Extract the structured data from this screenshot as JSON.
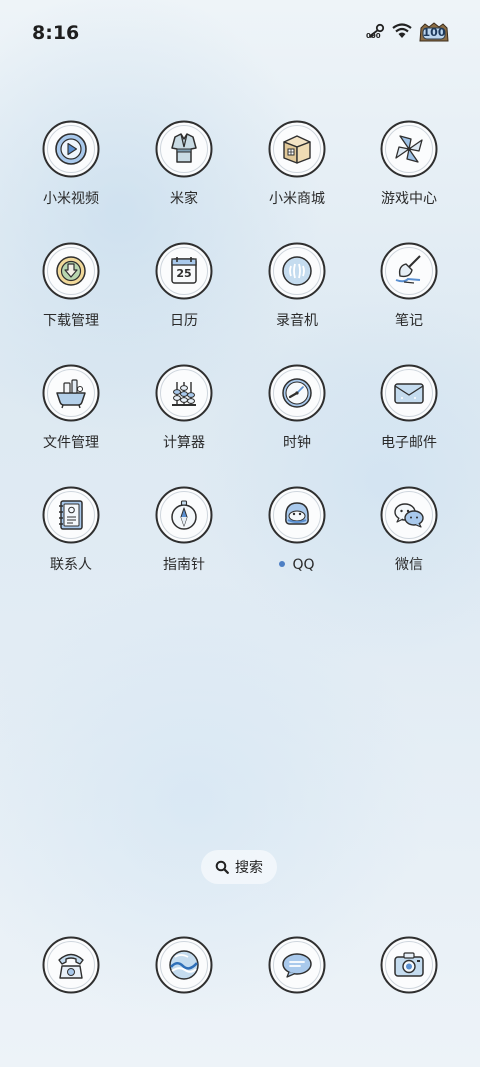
{
  "status_bar": {
    "time": "8:16",
    "battery_level": "100",
    "icons": [
      "key-icon",
      "wifi-icon",
      "battery-icon"
    ]
  },
  "apps": [
    {
      "label": "小米视频",
      "icon": "video-play-icon"
    },
    {
      "label": "米家",
      "icon": "robe-icon"
    },
    {
      "label": "小米商城",
      "icon": "shop-box-icon"
    },
    {
      "label": "游戏中心",
      "icon": "pinwheel-icon"
    },
    {
      "label": "下载管理",
      "icon": "download-arrow-icon"
    },
    {
      "label": "日历",
      "icon": "calendar-icon",
      "date": "25"
    },
    {
      "label": "录音机",
      "icon": "recorder-icon"
    },
    {
      "label": "笔记",
      "icon": "note-pen-icon"
    },
    {
      "label": "文件管理",
      "icon": "bathtub-files-icon"
    },
    {
      "label": "计算器",
      "icon": "abacus-icon"
    },
    {
      "label": "时钟",
      "icon": "clock-icon"
    },
    {
      "label": "电子邮件",
      "icon": "envelope-icon"
    },
    {
      "label": "联系人",
      "icon": "contacts-book-icon"
    },
    {
      "label": "指南针",
      "icon": "compass-icon"
    },
    {
      "label": "QQ",
      "icon": "qq-penguin-icon",
      "new_dot": true
    },
    {
      "label": "微信",
      "icon": "wechat-bubbles-icon"
    }
  ],
  "search": {
    "label": "搜索",
    "icon": "search-icon"
  },
  "dock": [
    {
      "icon": "telephone-icon"
    },
    {
      "icon": "browser-wave-icon"
    },
    {
      "icon": "message-bubble-icon"
    },
    {
      "icon": "camera-icon"
    }
  ],
  "colors": {
    "accent_blue": "#8fb6e0",
    "outline": "#3a3a3a",
    "dot_blue": "#4d7fc4"
  }
}
